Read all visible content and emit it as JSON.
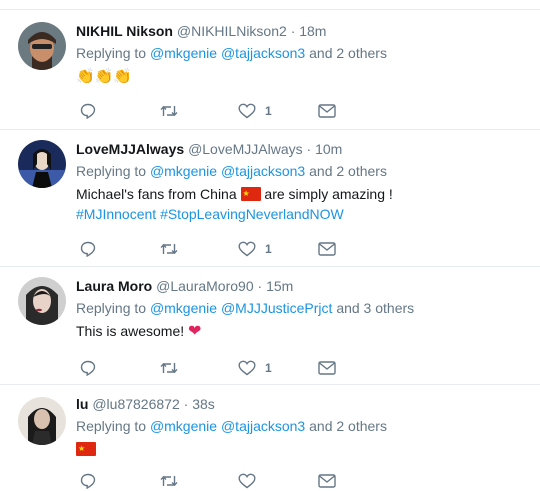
{
  "tweets": [
    {
      "name": "NIKHIL Nikson",
      "handle": "@NIKHILNikson2",
      "time": "· 18m",
      "replying_label": "Replying to",
      "mentions": [
        "@mkgenie",
        "@tajjackson3"
      ],
      "others": "and 2 others",
      "body_emojis": [
        "👏",
        "👏",
        "👏"
      ],
      "like_count": "1",
      "avatar_colors": [
        "#3b2a22",
        "#c98f6a"
      ]
    },
    {
      "name": "LoveMJJAlways",
      "handle": "@LoveMJJAlways",
      "time": "· 10m",
      "replying_label": "Replying to",
      "mentions": [
        "@mkgenie",
        "@tajjackson3"
      ],
      "others": "and 2 others",
      "text_before": "Michael's fans from China",
      "text_after": "are simply amazing !",
      "hashtags": [
        "#MJInnocent",
        "#StopLeavingNeverlandNOW"
      ],
      "like_count": "1",
      "avatar_colors": [
        "#0e1a38",
        "#e8d6c6"
      ]
    },
    {
      "name": "Laura Moro",
      "handle": "@LauraMoro90",
      "time": "· 15m",
      "replying_label": "Replying to",
      "mentions": [
        "@mkgenie",
        "@MJJJusticePrjct"
      ],
      "others": "and 3 others",
      "text": "This is awesome!",
      "heart": "❤",
      "like_count": "1",
      "avatar_colors": [
        "#2a2a2a",
        "#e7d3c8"
      ]
    },
    {
      "name": "lu",
      "handle": "@lu87826872",
      "time": "· 38s",
      "replying_label": "Replying to",
      "mentions": [
        "@mkgenie",
        "@tajjackson3"
      ],
      "others": "and 2 others",
      "like_count": "",
      "avatar_colors": [
        "#1b1b1b",
        "#d9c1b0"
      ]
    }
  ],
  "icons": {
    "reply": "reply-icon",
    "retweet": "retweet-icon",
    "like": "heart-icon",
    "dm": "message-icon"
  },
  "colors": {
    "link": "#1b95e0",
    "muted": "#657786",
    "divider": "#e6ecf0"
  }
}
